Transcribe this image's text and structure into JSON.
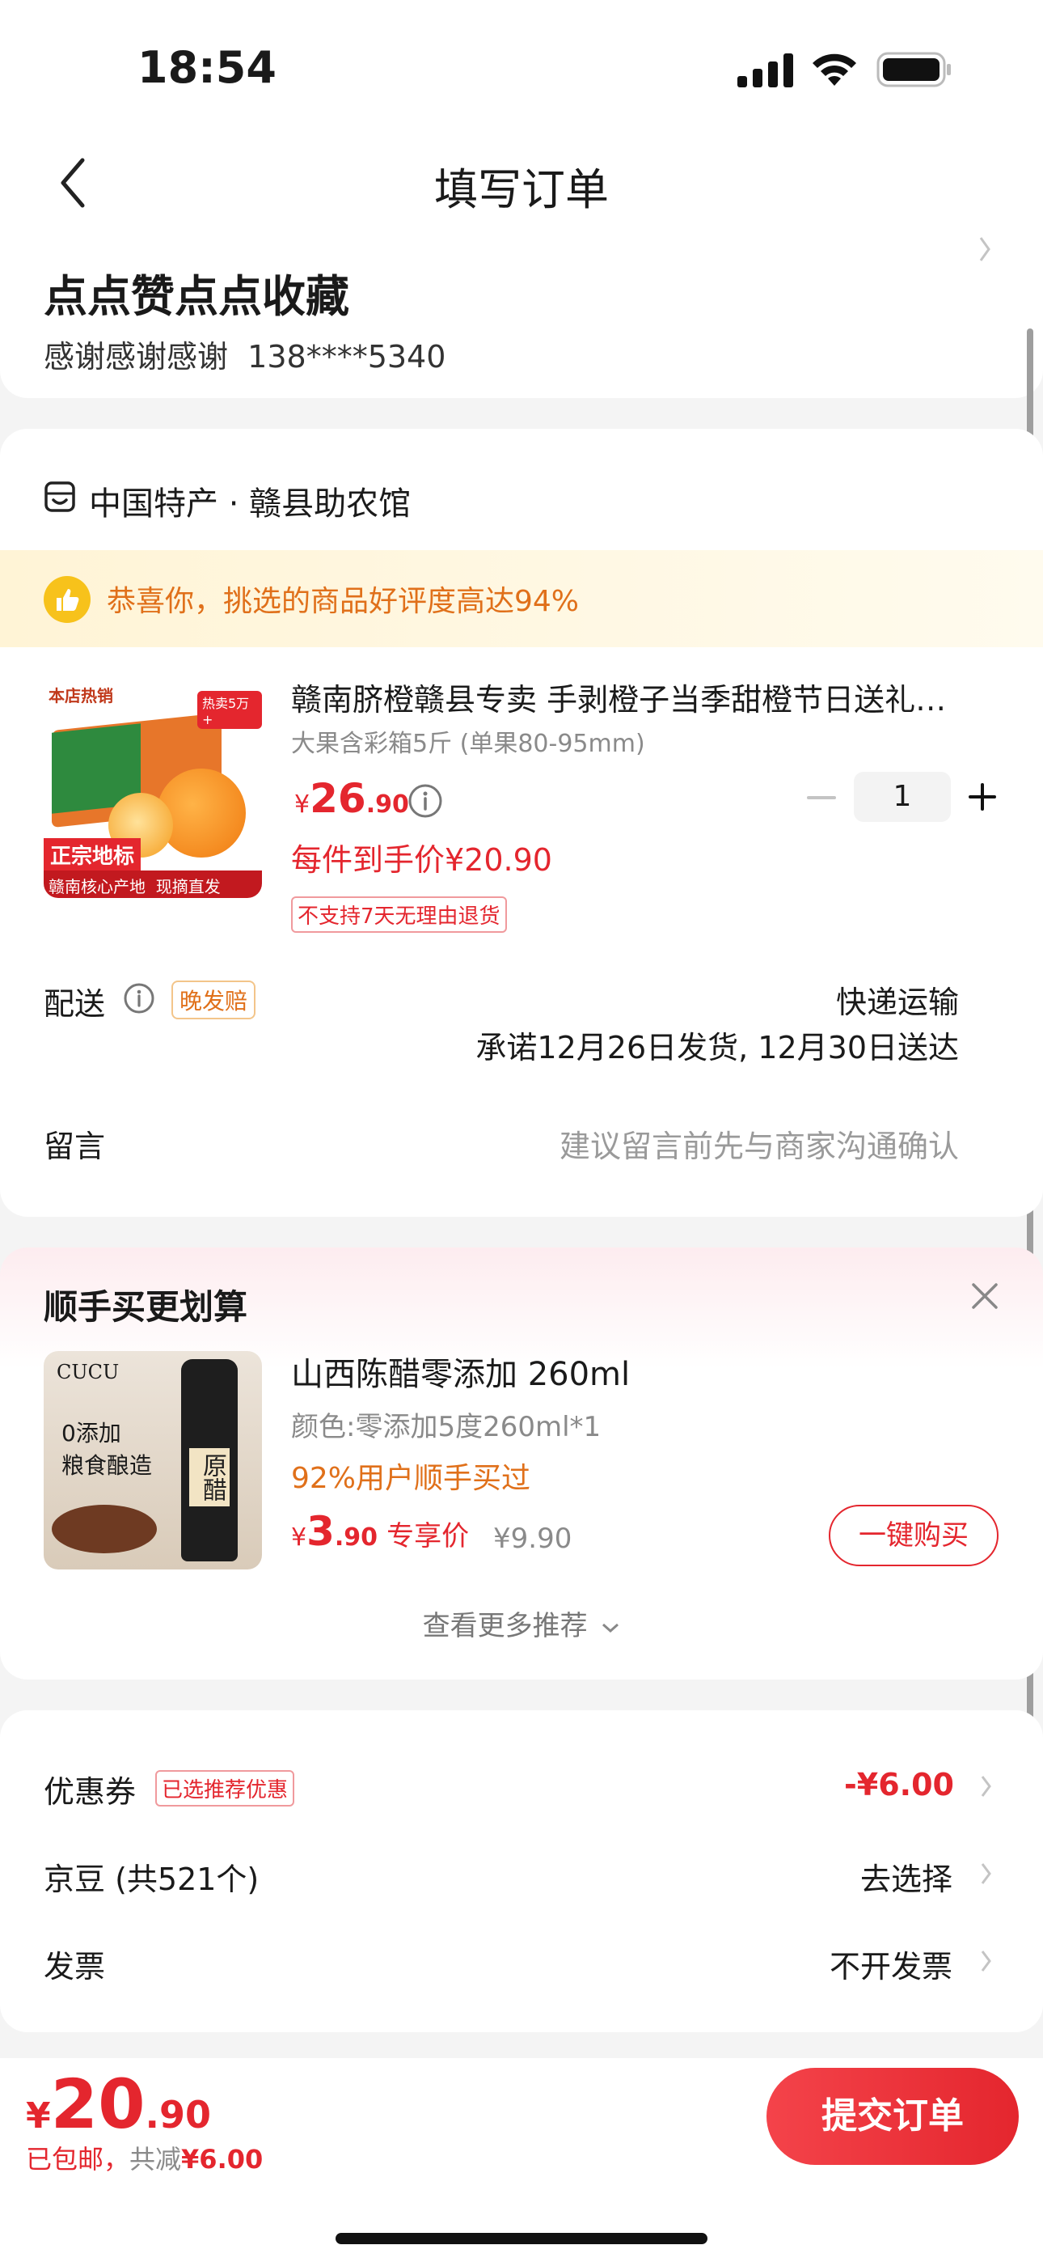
{
  "status_bar": {
    "time": "18:54"
  },
  "header": {
    "title": "填写订单"
  },
  "address": {
    "name": "点点赞点点收藏",
    "contact": "感谢感谢感谢  138****5340"
  },
  "store": {
    "name": "中国特产 · 赣县助农馆"
  },
  "banner": {
    "text": "恭喜你，挑选的商品好评度高达94%"
  },
  "product": {
    "image_tag_top": "本店热销",
    "image_badge": "热卖5万+",
    "image_label_1": "正宗地标",
    "image_label_2": "赣南核心产地  现摘直发",
    "title": "赣南脐橙赣县专卖 手剥橙子当季甜橙节日送礼…",
    "spec": "大果含彩箱5斤 (单果80-95mm)",
    "price_symbol": "¥",
    "price_int": "26",
    "price_dec": ".90",
    "quantity": "1",
    "final_price": "每件到手价¥20.90",
    "return_tag": "不支持7天无理由退货"
  },
  "delivery": {
    "label": "配送",
    "tag": "晚发赔",
    "method": "快递运输",
    "promise": "承诺12月26日发货, 12月30日送达"
  },
  "message": {
    "label": "留言",
    "placeholder": "建议留言前先与商家沟通确认"
  },
  "upsell": {
    "title": "顺手买更划算",
    "image_brand": "CUCU",
    "image_text_1": "0添加",
    "image_text_2": "粮食酿造",
    "image_bottle_text": "原醋",
    "item_title": "山西陈醋零添加 260ml",
    "item_spec": "颜色:零添加5度260ml*1",
    "item_social": "92%用户顺手买过",
    "price_symbol": "¥",
    "price_int": "3",
    "price_dec": ".90",
    "price_label": "专享价",
    "orig_price": "¥9.90",
    "buy_button": "一键购买",
    "more": "查看更多推荐"
  },
  "benefits": {
    "coupon_label": "优惠券",
    "coupon_tag": "已选推荐优惠",
    "coupon_value": "-¥6.00",
    "beans_label": "京豆 (共521个)",
    "beans_value": "去选择",
    "invoice_label": "发票",
    "invoice_value": "不开发票"
  },
  "footer": {
    "total_symbol": "¥",
    "total_int": "20",
    "total_dec": ".90",
    "shipping": "已包邮，",
    "saved_label": "共减",
    "saved_value": "¥6.00",
    "submit": "提交订单"
  },
  "colors": {
    "accent": "#e4262e",
    "orange": "#e0701a",
    "banner_bg": "#fff7e0"
  },
  "icons": [
    "back-icon",
    "cellular-icon",
    "wifi-icon",
    "battery-icon",
    "store-icon",
    "thumbs-up-icon",
    "info-icon",
    "minus-icon",
    "plus-icon",
    "close-icon",
    "chevron-right-icon",
    "chevron-down-icon"
  ]
}
